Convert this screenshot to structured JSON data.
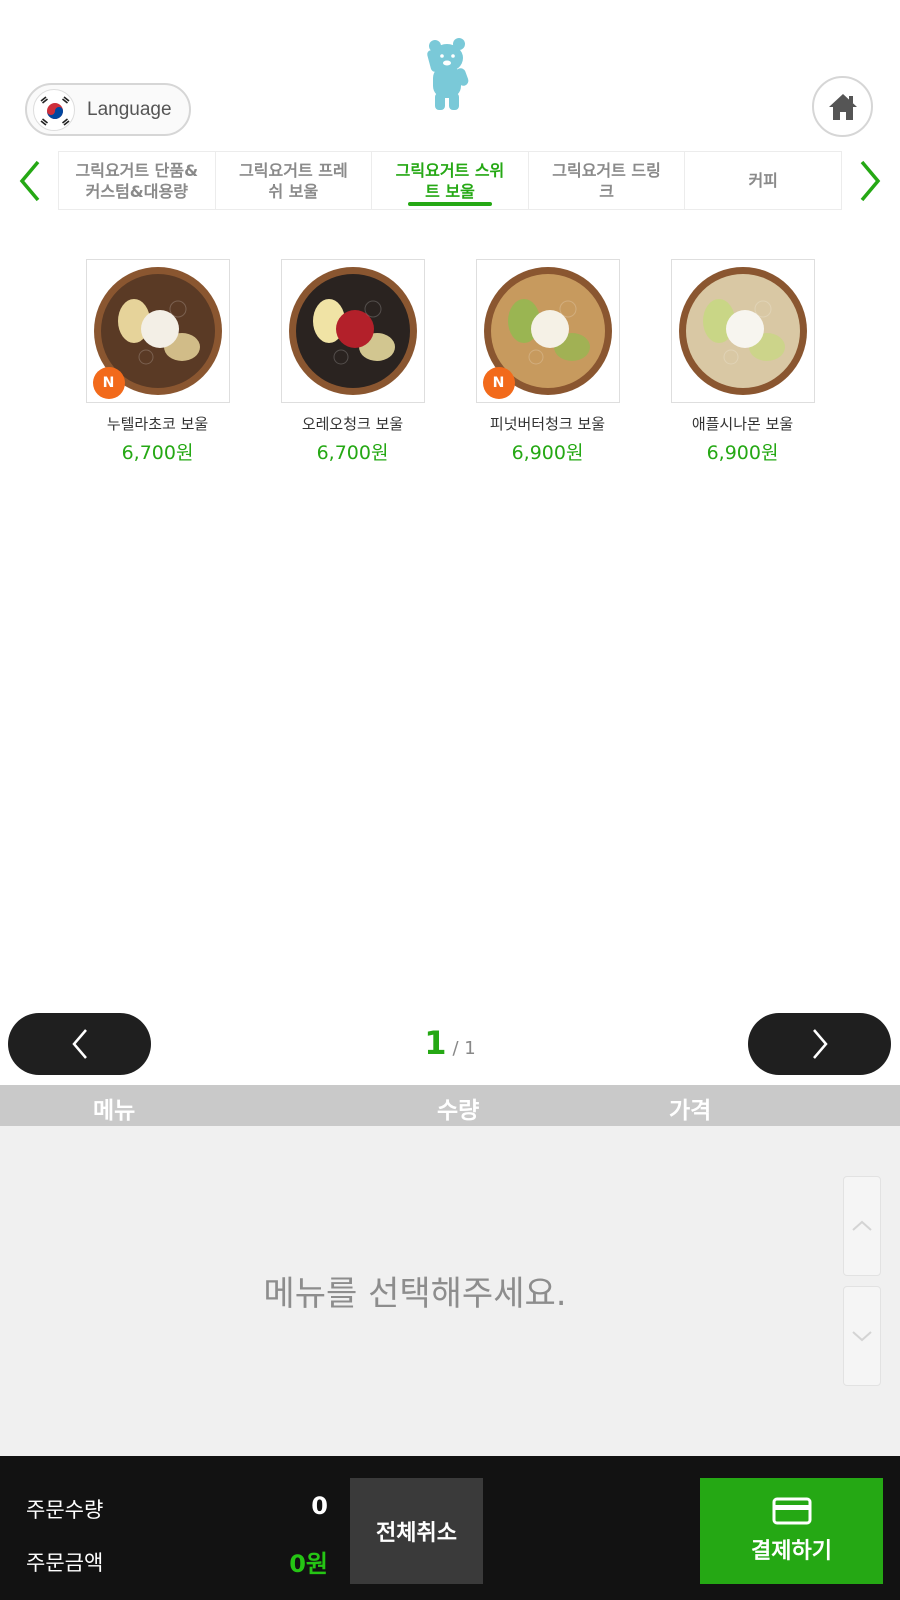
{
  "header": {
    "logo_icon": "bear-mascot-icon",
    "language_label": "Language",
    "flag_icon": "korea-flag-icon",
    "home_icon": "home-icon"
  },
  "categories": {
    "prev_icon": "chevron-left-icon",
    "next_icon": "chevron-right-icon",
    "tabs": [
      {
        "label": "그릭요거트 단품&\n커스텀&대용량",
        "active": false
      },
      {
        "label": "그릭요거트 프레\n쉬 보울",
        "active": false
      },
      {
        "label": "그릭요거트 스위\n트 보울",
        "active": true
      },
      {
        "label": "그릭요거트 드링\n크",
        "active": false
      },
      {
        "label": "커피",
        "active": false
      }
    ]
  },
  "products": [
    {
      "name": "누텔라초코 보울",
      "price": "6,700원",
      "badge": "N",
      "colors": [
        "#5a3a25",
        "#f3efe6",
        "#e6d39a"
      ]
    },
    {
      "name": "오레오청크 보울",
      "price": "6,700원",
      "badge": "",
      "colors": [
        "#2a2320",
        "#b3202a",
        "#f0e3a5"
      ]
    },
    {
      "name": "피넛버터청크 보울",
      "price": "6,900원",
      "badge": "N",
      "colors": [
        "#c79a5e",
        "#f5f1e6",
        "#9ab552"
      ]
    },
    {
      "name": "애플시나몬 보울",
      "price": "6,900원",
      "badge": "",
      "colors": [
        "#d9c8a4",
        "#f7f5ef",
        "#c9d686"
      ]
    }
  ],
  "pager": {
    "current": "1",
    "total": "/ 1",
    "prev_icon": "chevron-left-icon",
    "next_icon": "chevron-right-icon"
  },
  "order": {
    "col_menu": "메뉴",
    "col_qty": "수량",
    "col_price": "가격",
    "empty_message": "메뉴를 선택해주세요.",
    "scroll_up_icon": "chevron-up-icon",
    "scroll_down_icon": "chevron-down-icon"
  },
  "footer": {
    "qty_label": "주문수량",
    "qty_value": "0",
    "amount_label": "주문금액",
    "amount_value": "0원",
    "cancel_label": "전체취소",
    "pay_label": "결제하기",
    "pay_icon": "credit-card-icon"
  },
  "colors": {
    "accent": "#25a814",
    "dark": "#121212",
    "badge": "#f26a1b",
    "mascot": "#7ac9d8"
  }
}
